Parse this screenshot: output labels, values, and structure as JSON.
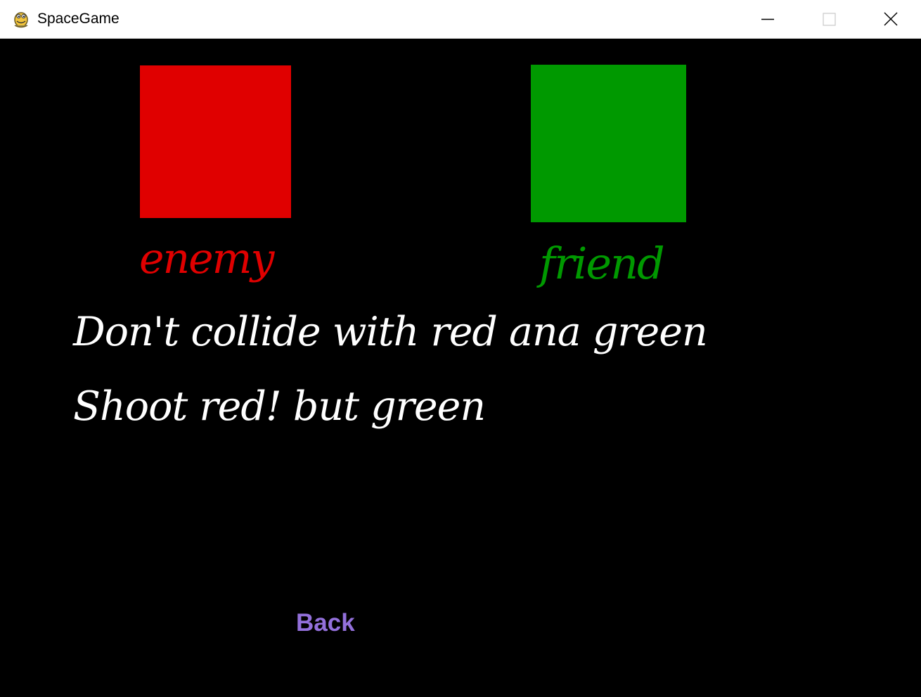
{
  "window": {
    "title": "SpaceGame",
    "app_icon": "pygame-snake-icon",
    "controls": {
      "minimize_icon": "minimize-icon",
      "maximize_icon": "maximize-icon",
      "close_icon": "close-icon"
    }
  },
  "game": {
    "background_color": "#000000",
    "enemy": {
      "label": "enemy",
      "color": "#e00000"
    },
    "friend": {
      "label": "friend",
      "color": "#009900"
    },
    "instructions": [
      "Don't collide with red ana green",
      "Shoot red! but green"
    ],
    "back_button": {
      "label": "Back",
      "color": "#9370db"
    }
  }
}
